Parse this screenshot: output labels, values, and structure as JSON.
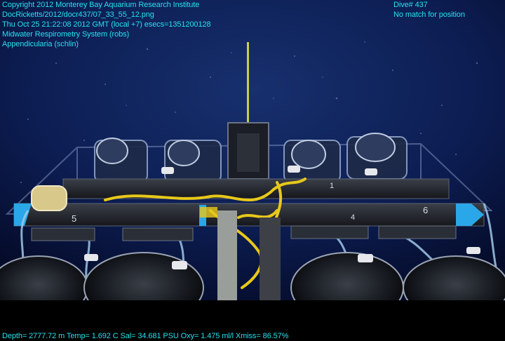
{
  "overlay": {
    "top_left": [
      "Copyright 2012 Monterey Bay Aquarium Research Institute",
      "DocRicketts/2012/docr437/07_33_55_12.png",
      "Thu Oct 25 21:22:08 2012 GMT (local +7)  esecs=1351200128",
      "Midwater Respirometry System (robs)",
      "Appendicularia (schlin)"
    ],
    "top_right": [
      "Dive# 437",
      "No match for position"
    ],
    "bottom": "Depth= 2777.72 m  Temp= 1.692 C  Sal= 34.681 PSU  Oxy= 1.475 ml/l  Xmiss= 86.57%"
  },
  "scene": {
    "chamber_labels": [
      "5",
      "6",
      "1",
      "4"
    ]
  },
  "colors": {
    "overlay_text": "#27e0ee",
    "water": "#0a1a4a",
    "rope": "#e8c81a",
    "accent_blue": "#2aa7e8"
  }
}
